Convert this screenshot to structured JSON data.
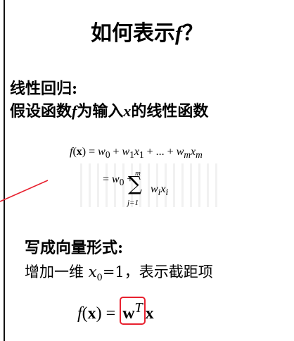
{
  "slide": {
    "title": "如何表示f？",
    "section_heading": "线性回归:",
    "subtitle": "假设函数f为输入x的线性函数",
    "vector_heading": "写成向量形式:",
    "vector_description": "增加一维 x0=1，表示截距项"
  },
  "equations": {
    "line1": "f(x) = w0 + w1x1 + ... + wmxm",
    "line2": "= w0 + Σ_{j=1}^{m} wixi",
    "vector_form": "f(x) = wTx"
  },
  "colors": {
    "annotation_red": "#e8212f",
    "text": "#000000"
  }
}
